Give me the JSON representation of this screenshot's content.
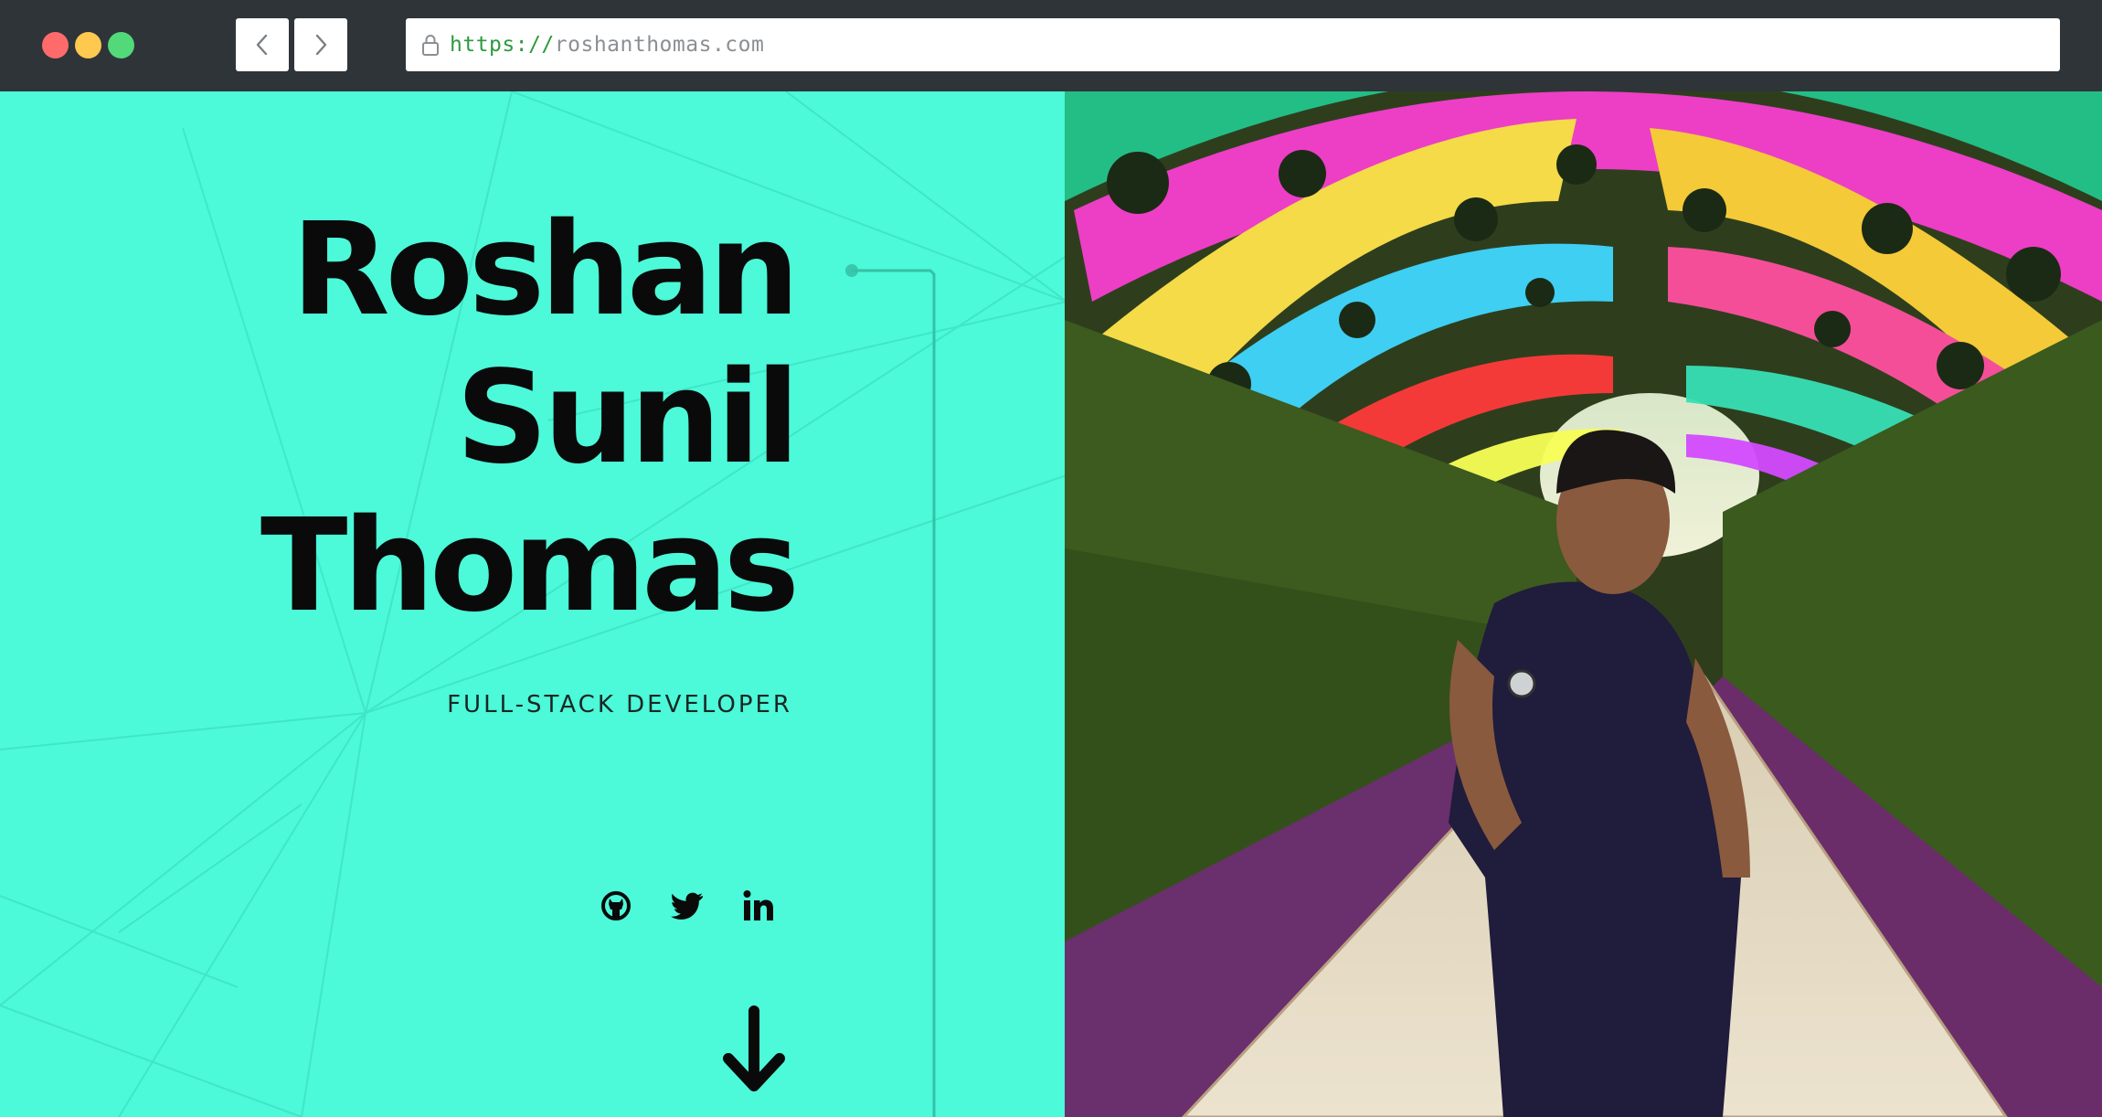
{
  "browser": {
    "url_scheme": "https://",
    "url_host": "roshanthomas.com"
  },
  "hero": {
    "name_lines": [
      "Roshan",
      "Sunil",
      "Thomas"
    ],
    "role": "FULL-STACK DEVELOPER"
  },
  "icons": {
    "social": [
      "github-icon",
      "twitter-icon",
      "linkedin-icon"
    ],
    "scroll": "arrow-down-icon"
  },
  "colors": {
    "accent": "#4cf9d8",
    "chrome": "#2f3439",
    "text": "#0a0a0a",
    "url_scheme": "#2e9a3e",
    "url_host": "#8b8f93"
  }
}
